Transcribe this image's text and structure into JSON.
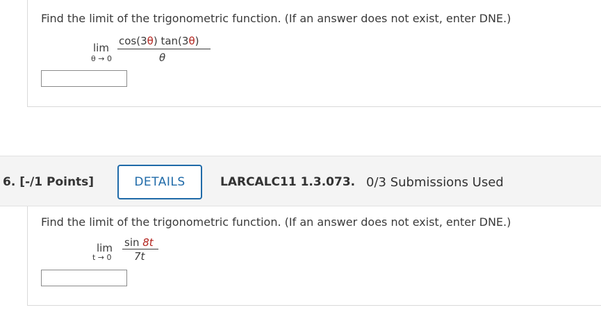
{
  "question5": {
    "prompt": "Find the limit of the trigonometric function. (If an answer does not exist, enter DNE.)",
    "lim": "lim",
    "lim_subscript": "θ → 0",
    "numerator_part1": "cos(3",
    "numerator_theta1": "θ",
    "numerator_part2": ") tan(3",
    "numerator_theta2": "θ",
    "numerator_part3": ")",
    "denominator": "θ",
    "answer_value": ""
  },
  "question6": {
    "number_label": "6.  [-/1 Points]",
    "details_label": "DETAILS",
    "source_ref": "LARCALC11 1.3.073.",
    "submissions": "0/3 Submissions Used",
    "prompt": "Find the limit of the trigonometric function. (If an answer does not exist, enter DNE.)",
    "lim": "lim",
    "lim_subscript": "t → 0",
    "numerator_fn": "sin ",
    "numerator_arg": "8t",
    "denominator": "7t",
    "answer_value": ""
  },
  "colors": {
    "accent": "#1f6aa8",
    "variable_red": "#b2231d",
    "header_bg": "#f4f4f4"
  }
}
